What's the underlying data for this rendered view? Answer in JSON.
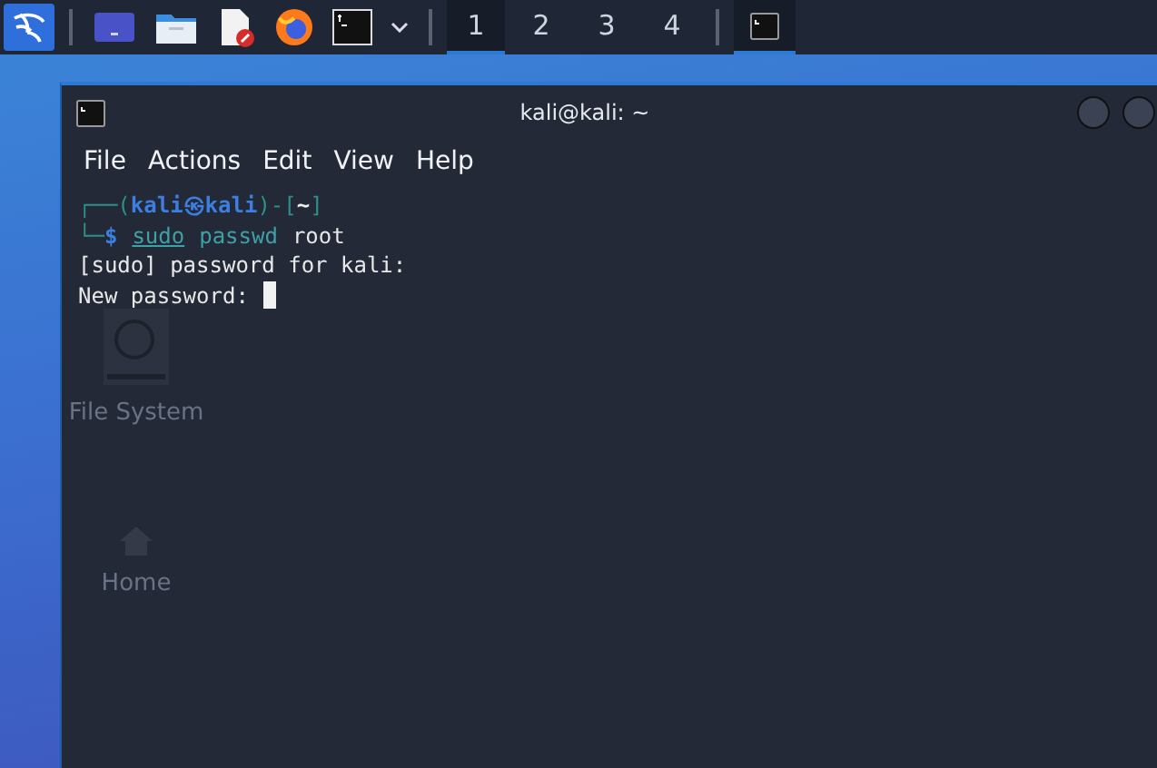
{
  "taskbar": {
    "launchers": [
      {
        "kind": "kali-menu"
      },
      {
        "kind": "desktop"
      },
      {
        "kind": "files"
      },
      {
        "kind": "editor"
      },
      {
        "kind": "browser"
      },
      {
        "kind": "terminal"
      },
      {
        "kind": "chevron"
      }
    ],
    "workspaces": [
      {
        "label": "1",
        "selected": true
      },
      {
        "label": "2",
        "selected": false
      },
      {
        "label": "3",
        "selected": false
      },
      {
        "label": "4",
        "selected": false
      }
    ],
    "tasks": [
      {
        "kind": "terminal",
        "selected": true
      }
    ]
  },
  "desktop_icons": [
    {
      "kind": "drive",
      "label": "File System"
    },
    {
      "kind": "home",
      "label": "Home"
    }
  ],
  "window": {
    "title": "kali@kali: ~",
    "menu": [
      "File",
      "Actions",
      "Edit",
      "View",
      "Help"
    ],
    "lines": [
      {
        "cursor": false,
        "segments": [
          {
            "kind": "frame",
            "text": "┌──("
          },
          {
            "kind": "user",
            "text": "kali㉿kali"
          },
          {
            "kind": "frame",
            "text": ")-["
          },
          {
            "kind": "dir",
            "text": "~"
          },
          {
            "kind": "frame",
            "text": "]"
          }
        ]
      },
      {
        "cursor": false,
        "segments": [
          {
            "kind": "frame",
            "text": "└─"
          },
          {
            "kind": "user",
            "text": "$"
          },
          {
            "kind": "cmd",
            "text": "sudo"
          },
          {
            "kind": "arg",
            "text": "passwd"
          },
          {
            "kind": "plain",
            "text": "root"
          }
        ]
      },
      {
        "cursor": false,
        "segments": [
          {
            "kind": "plain",
            "text": "[sudo] password for kali:"
          }
        ]
      },
      {
        "cursor": true,
        "segments": [
          {
            "kind": "plain",
            "text": "New password:"
          }
        ]
      }
    ]
  }
}
